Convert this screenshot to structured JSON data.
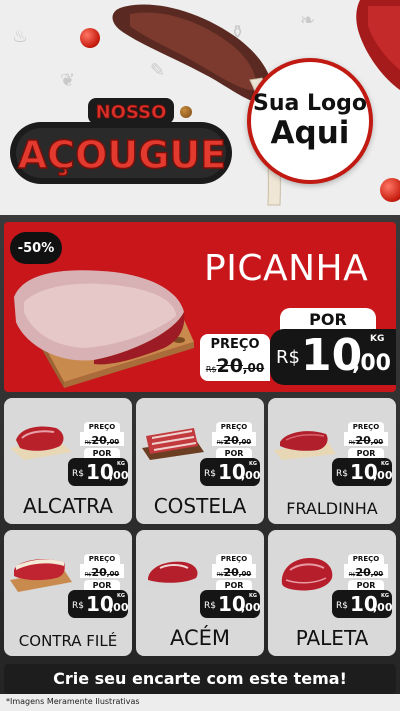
{
  "header": {
    "title_top": "NOSSO",
    "title_main": "AÇOUGUE",
    "logo_line1": "Sua Logo",
    "logo_line2": "Aqui"
  },
  "hero": {
    "discount": "-50%",
    "name": "PICANHA",
    "preco_label": "PREÇO",
    "old_currency": "R$",
    "old_int": "20",
    "old_dec": ",00",
    "por_label": "POR",
    "currency": "R$",
    "price_int": "10",
    "price_dec": ",00",
    "unit": "KG"
  },
  "products": [
    {
      "name": "ALCATRA",
      "preco_label": "PREÇO",
      "old_currency": "R$",
      "old_int": "20",
      "old_dec": ",00",
      "por_label": "POR",
      "currency": "R$",
      "price_int": "10",
      "price_dec": ",00",
      "unit": "KG"
    },
    {
      "name": "COSTELA",
      "preco_label": "PREÇO",
      "old_currency": "R$",
      "old_int": "20",
      "old_dec": ",00",
      "por_label": "POR",
      "currency": "R$",
      "price_int": "10",
      "price_dec": ",00",
      "unit": "KG"
    },
    {
      "name": "FRALDINHA",
      "preco_label": "PREÇO",
      "old_currency": "R$",
      "old_int": "20",
      "old_dec": ",00",
      "por_label": "POR",
      "currency": "R$",
      "price_int": "10",
      "price_dec": ",00",
      "unit": "KG"
    },
    {
      "name": "CONTRA FILÉ",
      "preco_label": "PREÇO",
      "old_currency": "R$",
      "old_int": "20",
      "old_dec": ",00",
      "por_label": "POR",
      "currency": "R$",
      "price_int": "10",
      "price_dec": ",00",
      "unit": "KG"
    },
    {
      "name": "ACÉM",
      "preco_label": "PREÇO",
      "old_currency": "R$",
      "old_int": "20",
      "old_dec": ",00",
      "por_label": "POR",
      "currency": "R$",
      "price_int": "10",
      "price_dec": ",00",
      "unit": "KG"
    },
    {
      "name": "PALETA",
      "preco_label": "PREÇO",
      "old_currency": "R$",
      "old_int": "20",
      "old_dec": ",00",
      "por_label": "POR",
      "currency": "R$",
      "price_int": "10",
      "price_dec": ",00",
      "unit": "KG"
    }
  ],
  "footer": {
    "cta": "Crie seu encarte com este tema!",
    "disclaimer": "*Imagens Meramente Ilustrativas"
  },
  "colors": {
    "brand_red": "#c8161b",
    "dark": "#151515",
    "card_bg": "#d9d9d9"
  },
  "icons": [
    "steak-image",
    "tomato-image",
    "picanha-image",
    "cutting-board-image"
  ]
}
